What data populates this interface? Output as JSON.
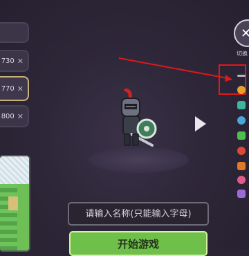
{
  "units": [
    {
      "cost": "",
      "icon": "x-icon"
    },
    {
      "cost": "730",
      "icon": "x-icon"
    },
    {
      "cost": "770",
      "icon": "x-icon",
      "selected": true
    },
    {
      "cost": "800",
      "icon": "x-icon"
    }
  ],
  "right_panel": {
    "tools_icon": "crossed-tools-icon",
    "label": "切换"
  },
  "items": [
    {
      "name": "sword-icon",
      "color": "#b8b0c4"
    },
    {
      "name": "helmet-icon",
      "color": "#e6a02c"
    },
    {
      "name": "heart-icon",
      "color": "#3fb5a0"
    },
    {
      "name": "drop-icon",
      "color": "#4aa7d8"
    },
    {
      "name": "leaf-icon",
      "color": "#4cbf4c"
    },
    {
      "name": "dagger-icon",
      "color": "#d84a3a"
    },
    {
      "name": "flame-icon",
      "color": "#e07a2a"
    },
    {
      "name": "shield-icon",
      "color": "#e05a8a"
    },
    {
      "name": "gem-icon",
      "color": "#9a6ad8"
    }
  ],
  "annotation": {
    "color": "#e01818"
  },
  "name_input": {
    "placeholder": "请输入名称(只能输入字母)"
  },
  "start_button": {
    "label": "开始游戏"
  }
}
